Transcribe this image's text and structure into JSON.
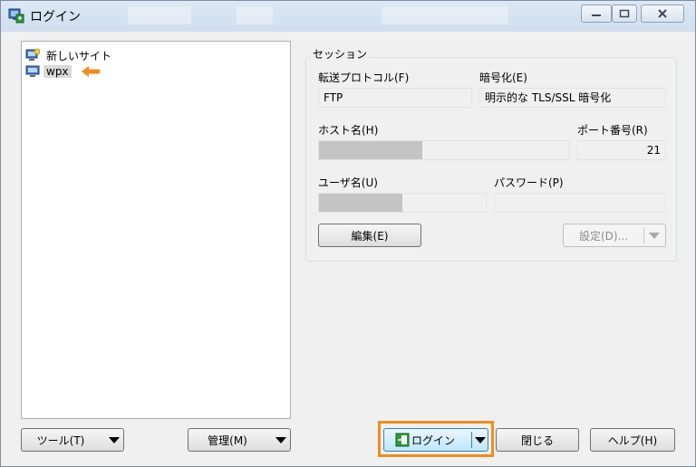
{
  "window": {
    "title": "ログイン",
    "minimize_icon": "minimize-icon",
    "maximize_icon": "maximize-icon",
    "close_icon": "close-icon"
  },
  "site_tree": {
    "items": [
      {
        "label": "新しいサイト",
        "icon": "new-site-icon"
      },
      {
        "label": "wpx",
        "icon": "computer-icon",
        "selected": true
      }
    ],
    "pointer_icon": "orange-arrow-left-icon"
  },
  "session": {
    "group_title": "セッション",
    "protocol_label": "転送プロトコル(F)",
    "protocol_value": "FTP",
    "encryption_label": "暗号化(E)",
    "encryption_value": "明示的な TLS/SSL 暗号化",
    "host_label": "ホスト名(H)",
    "host_value": "",
    "port_label": "ポート番号(R)",
    "port_value": "21",
    "user_label": "ユーザ名(U)",
    "user_value": "",
    "password_label": "パスワード(P)",
    "password_value": "",
    "edit_button": "編集(E)",
    "settings_button": "設定(D)..."
  },
  "footer": {
    "tools_button": "ツール(T)",
    "manage_button": "管理(M)",
    "login_button": "ログイン",
    "close_button": "閉じる",
    "help_button": "ヘルプ(H)"
  },
  "colors": {
    "highlight": "#f28c1b",
    "pointer_arrow": "#f28c1b"
  }
}
